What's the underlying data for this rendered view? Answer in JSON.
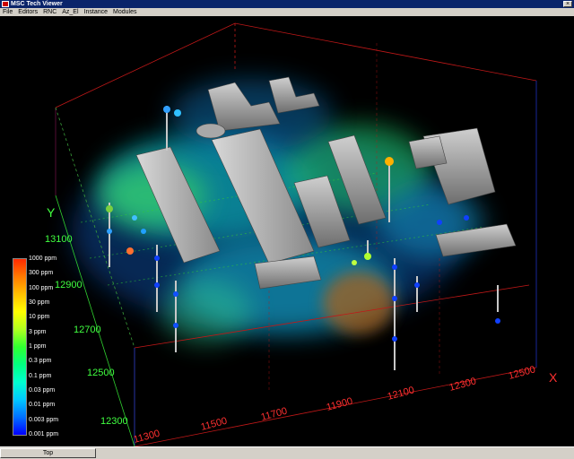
{
  "window": {
    "title": "MSC Tech Viewer",
    "close_glyph": "×"
  },
  "menu": [
    "File",
    "Editors",
    "RNC",
    "Az_El",
    "Instance",
    "Modules"
  ],
  "legend": {
    "labels": [
      "1000 ppm",
      "300 ppm",
      "100 ppm",
      "30 ppm",
      "10 ppm",
      "3 ppm",
      "1 ppm",
      "0.3 ppm",
      "0.1 ppm",
      "0.03 ppm",
      "0.01 ppm",
      "0.003 ppm",
      "0.001 ppm"
    ]
  },
  "axes": {
    "x_title": "X",
    "y_title": "Y",
    "x_ticks": [
      "11300",
      "11500",
      "11700",
      "11900",
      "12100",
      "12300",
      "12500"
    ],
    "y_ticks": [
      "12300",
      "12500",
      "12700",
      "12900",
      "13100"
    ]
  },
  "status": {
    "view_button": "Top"
  },
  "colors": {
    "x_axis": "#ff3030",
    "y_axis": "#40ff40",
    "titlebar": "#0a246a",
    "chrome": "#d4d0c8"
  }
}
